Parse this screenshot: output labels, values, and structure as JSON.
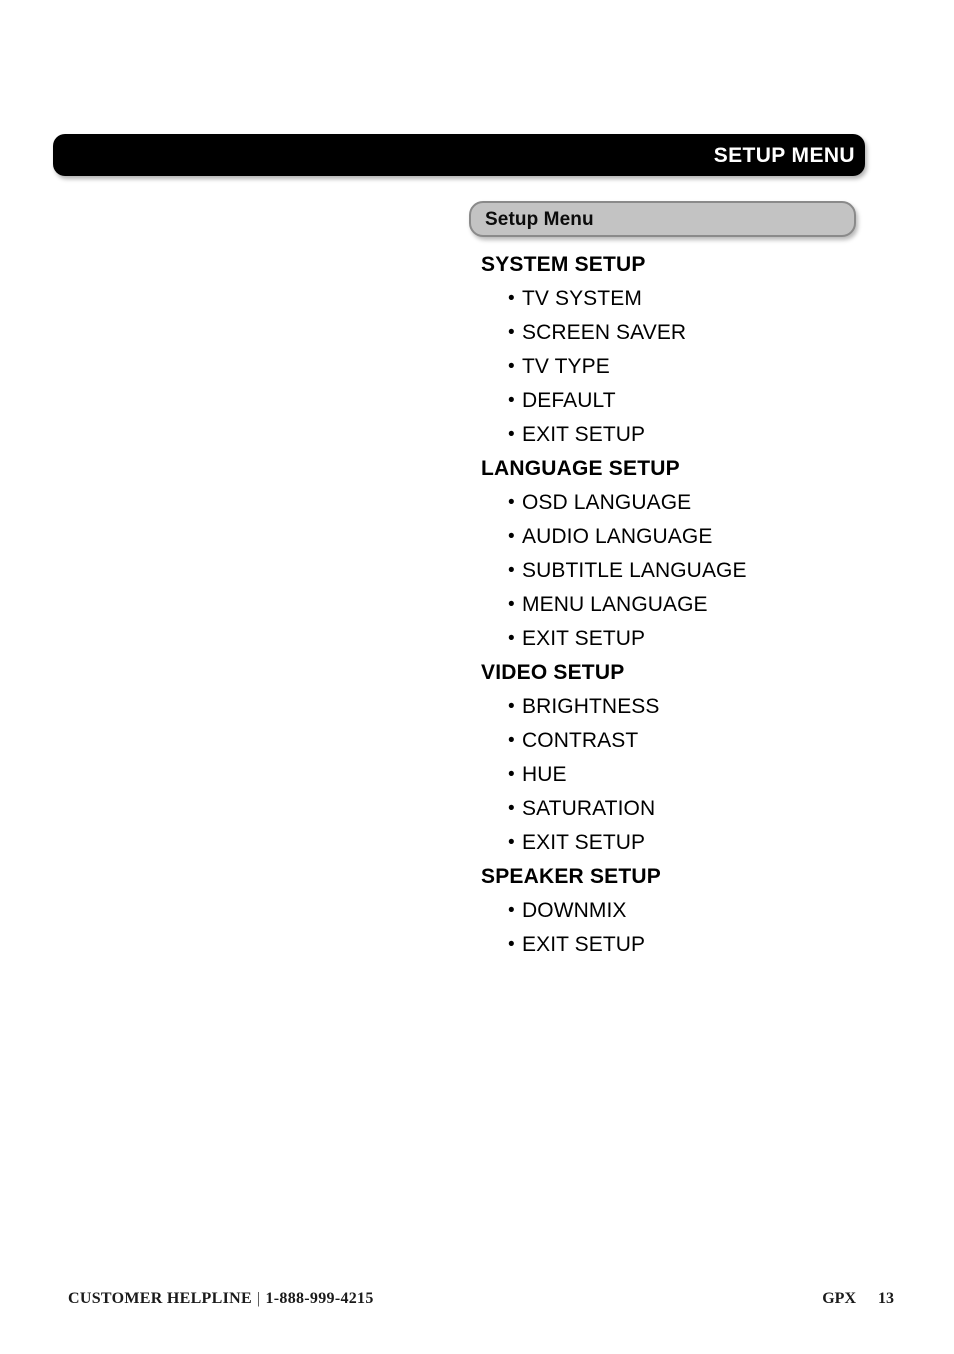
{
  "header": {
    "title": "SETUP MENU"
  },
  "menu_pill": {
    "label": "Setup Menu"
  },
  "bullet_glyph": "•",
  "sections": [
    {
      "heading": "SYSTEM SETUP",
      "items": [
        "TV SYSTEM",
        "SCREEN SAVER",
        "TV TYPE",
        "DEFAULT",
        "EXIT SETUP"
      ]
    },
    {
      "heading": "LANGUAGE SETUP",
      "items": [
        "OSD LANGUAGE",
        "AUDIO LANGUAGE",
        "SUBTITLE LANGUAGE",
        "MENU LANGUAGE",
        "EXIT SETUP"
      ]
    },
    {
      "heading": "VIDEO SETUP",
      "items": [
        "BRIGHTNESS",
        "CONTRAST",
        "HUE",
        "SATURATION",
        "EXIT SETUP"
      ]
    },
    {
      "heading": "SPEAKER SETUP",
      "items": [
        "DOWNMIX",
        "EXIT SETUP"
      ]
    }
  ],
  "footer": {
    "helpline_label": "CUSTOMER HELPLINE",
    "separator": "|",
    "phone": "1-888-999-4215",
    "brand": "GPX",
    "page_number": "13"
  },
  "colors": {
    "header_bar": "#000000",
    "header_text": "#ffffff",
    "pill_fill": "#c3c3c3",
    "pill_border": "#8a8a8a",
    "text": "#000000",
    "page_background": "#ffffff"
  }
}
